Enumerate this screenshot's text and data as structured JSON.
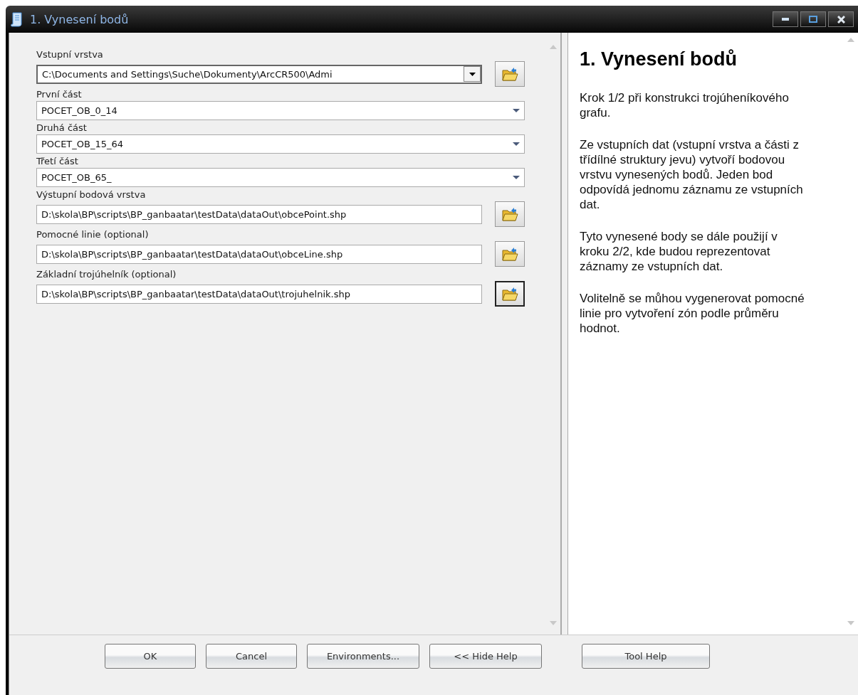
{
  "window": {
    "title": "1. Vynesení bodů"
  },
  "parameters": [
    {
      "kind": "combo-path",
      "label": "Vstupní vrstva",
      "value": "C:\\Documents and Settings\\Suche\\Dokumenty\\ArcCR500\\Admi",
      "focused": false
    },
    {
      "kind": "dropdown",
      "label": "První část",
      "value": "POCET_OB_0_14"
    },
    {
      "kind": "dropdown",
      "label": "Druhá část",
      "value": "POCET_OB_15_64"
    },
    {
      "kind": "dropdown",
      "label": "Třetí část",
      "value": "POCET_OB_65_"
    },
    {
      "kind": "path",
      "label": "Výstupní bodová vrstva",
      "value": "D:\\skola\\BP\\scripts\\BP_ganbaatar\\testData\\dataOut\\obcePoint.shp",
      "focused": false
    },
    {
      "kind": "path",
      "label": "Pomocné linie (optional)",
      "value": "D:\\skola\\BP\\scripts\\BP_ganbaatar\\testData\\dataOut\\obceLine.shp",
      "focused": false
    },
    {
      "kind": "path",
      "label": "Základní trojúhelník (optional)",
      "value": "D:\\skola\\BP\\scripts\\BP_ganbaatar\\testData\\dataOut\\trojuhelnik.shp",
      "focused": true
    }
  ],
  "help": {
    "title": "1. Vynesení bodů",
    "paragraphs": [
      "Krok 1/2 při konstrukci trojúheníkového grafu.",
      "Ze vstupních dat (vstupní vrstva a části z třídílné struktury jevu) vytvoří bodovou vrstvu vynesených bodů. Jeden bod odpovídá jednomu záznamu ze vstupních dat.",
      "Tyto vynesené body se dále použijí v kroku 2/2, kde budou reprezentovat záznamy ze vstupních dat.",
      "Volitelně se můhou vygenerovat pomocné linie pro vytvoření zón podle průměru hodnot."
    ]
  },
  "buttons": [
    "OK",
    "Cancel",
    "Environments...",
    "<< Hide Help",
    "Tool Help"
  ]
}
